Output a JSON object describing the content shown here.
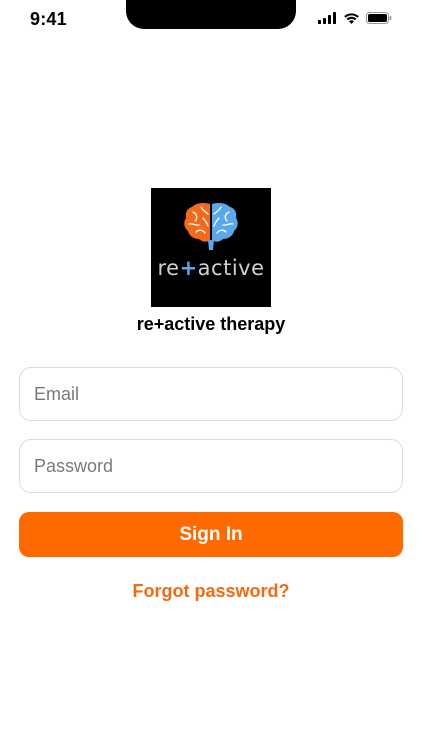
{
  "status_bar": {
    "time": "9:41",
    "icons": [
      "cellular-signal-icon",
      "wifi-icon",
      "battery-icon"
    ]
  },
  "logo": {
    "word_prefix": "re",
    "word_plus": "+",
    "word_suffix": "active",
    "colors": {
      "left_brain": "#f26b1d",
      "right_brain": "#5aa8ec",
      "background": "#000000"
    }
  },
  "app_name": "re+active therapy",
  "form": {
    "email_placeholder": "Email",
    "password_placeholder": "Password",
    "sign_in_label": "Sign In",
    "forgot_password_label": "Forgot password?"
  },
  "colors": {
    "accent": "#ff6a00",
    "link": "#f26b0f"
  }
}
